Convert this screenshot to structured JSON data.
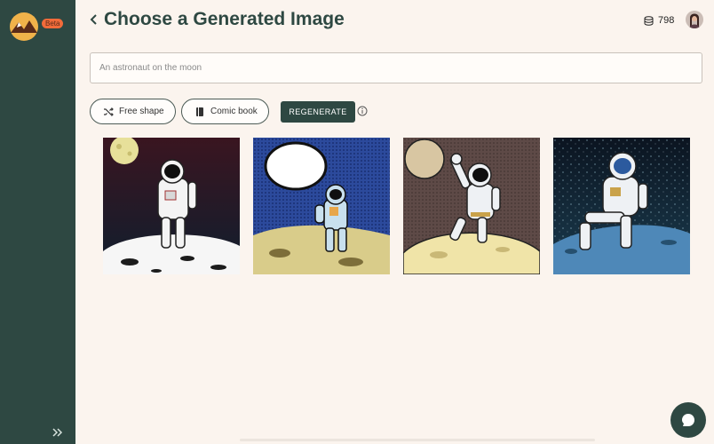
{
  "sidebar": {
    "logo_icon": "mountain-sun-logo",
    "badge": "Beta",
    "expand_icon": "double-chevron-right-icon"
  },
  "header": {
    "back_icon": "chevron-left-icon",
    "title": "Choose a Generated Image",
    "credits_icon": "coins-stack-icon",
    "credits": "798"
  },
  "prompt": {
    "placeholder": "An astronaut on the moon",
    "value": ""
  },
  "options": {
    "shape_label": "Free shape",
    "shape_icon": "shuffle-icon",
    "style_label": "Comic book",
    "style_icon": "book-icon",
    "regenerate_label": "REGENERATE",
    "info_icon": "info-icon"
  },
  "images": [
    {
      "name": "astronaut-dark-sky"
    },
    {
      "name": "astronaut-comic-speech-bubble"
    },
    {
      "name": "astronaut-waving-halftone"
    },
    {
      "name": "astronaut-sitting-starry"
    }
  ],
  "chat_icon": "chat-bubble-icon",
  "colors": {
    "brand": "#2e4842",
    "background": "#fbf4ee",
    "beta_badge": "#f26b3a"
  }
}
